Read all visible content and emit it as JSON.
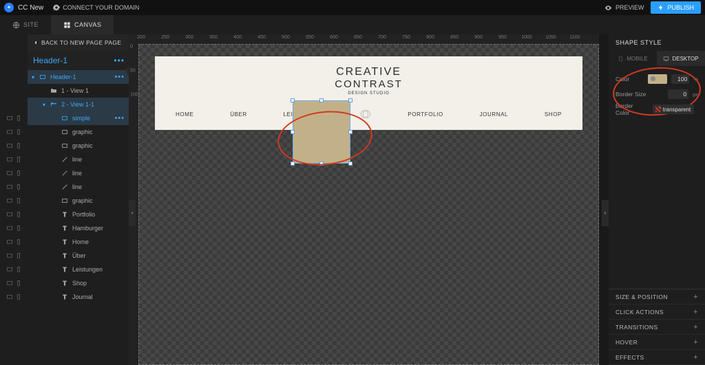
{
  "topbar": {
    "app_name": "CC New",
    "connect_label": "CONNECT YOUR DOMAIN",
    "preview_label": "PREVIEW",
    "publish_label": "PUBLISH"
  },
  "modetabs": {
    "site": "SITE",
    "canvas": "CANVAS"
  },
  "left": {
    "back": "BACK TO NEW PAGE PAGE",
    "page_name": "Header-1",
    "tree": [
      {
        "label": "Header-1",
        "type": "rect",
        "level": 1,
        "selected": true,
        "dots": true,
        "tri": true
      },
      {
        "label": "1 - View 1",
        "type": "folder",
        "level": 2
      },
      {
        "label": "2 - View 1-1",
        "type": "folder-open",
        "level": 2,
        "selected": true,
        "tri": true
      },
      {
        "label": "simple",
        "type": "rect",
        "level": 3,
        "selected": true,
        "dots": true
      },
      {
        "label": "graphic",
        "type": "rect",
        "level": 3
      },
      {
        "label": "graphic",
        "type": "rect",
        "level": 3
      },
      {
        "label": "line",
        "type": "line",
        "level": 3
      },
      {
        "label": "line",
        "type": "line",
        "level": 3
      },
      {
        "label": "line",
        "type": "line",
        "level": 3
      },
      {
        "label": "graphic",
        "type": "rect",
        "level": 3
      },
      {
        "label": "Portfolio",
        "type": "text",
        "level": 3
      },
      {
        "label": "Hamburger",
        "type": "text",
        "level": 3
      },
      {
        "label": "Home",
        "type": "text",
        "level": 3
      },
      {
        "label": "Über",
        "type": "text",
        "level": 3
      },
      {
        "label": "Leistungen",
        "type": "text",
        "level": 3
      },
      {
        "label": "Shop",
        "type": "text",
        "level": 3
      },
      {
        "label": "Journal",
        "type": "text",
        "level": 3
      }
    ]
  },
  "ruler_h": [
    "200",
    "250",
    "300",
    "350",
    "400",
    "450",
    "500",
    "550",
    "600",
    "650",
    "700",
    "750",
    "800",
    "850",
    "900",
    "950",
    "1000",
    "1050",
    "1100"
  ],
  "ruler_v": [
    "0",
    "50",
    "100"
  ],
  "site": {
    "brand_l1": "CREATIVE",
    "brand_l2": "CONTRAST",
    "brand_sub": "DESIGN STUDIO",
    "nav": [
      "HOME",
      "ÜBER",
      "LEISTUNGEN",
      "PORTFOLIO",
      "JOURNAL",
      "SHOP"
    ]
  },
  "right": {
    "title": "SHAPE STYLE",
    "tabs": {
      "mobile": "MOBILE",
      "desktop": "DESKTOP"
    },
    "color_label": "Color",
    "color_opacity": "100",
    "color_unit": "%",
    "border_size_label": "Border Size",
    "border_size_value": "0",
    "border_size_unit": "px",
    "border_color_label": "Border Color",
    "border_color_value": "transparent",
    "accordion": [
      "SIZE & POSITION",
      "CLICK ACTIONS",
      "TRANSITIONS",
      "HOVER",
      "EFFECTS"
    ]
  },
  "shape_color": "#c2b188"
}
